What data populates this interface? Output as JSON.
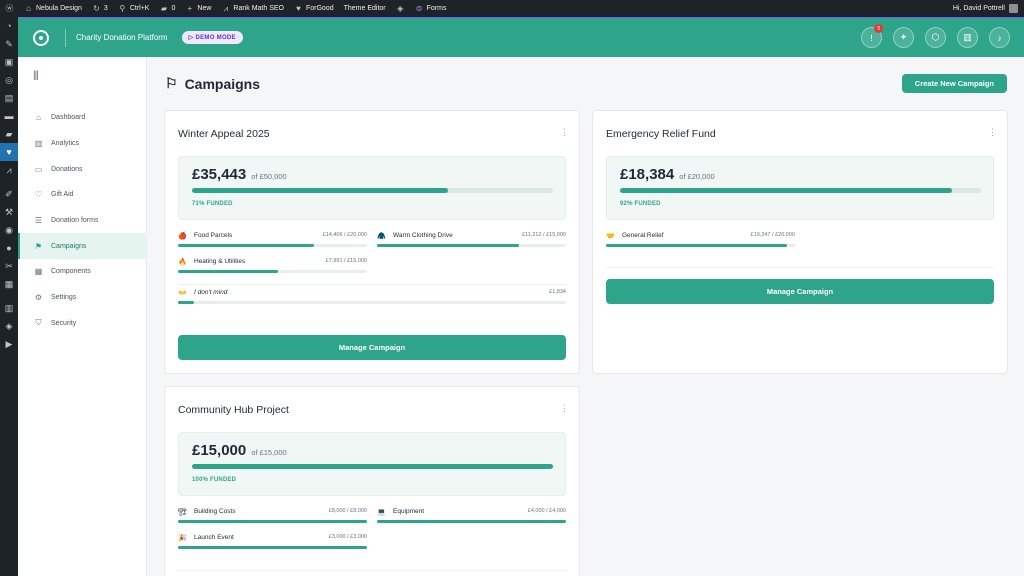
{
  "adminbar": {
    "site_name": "Nebula Design",
    "updates_count": "3",
    "shortcut": "Ctrl+K",
    "comments_count": "0",
    "new_label": "New",
    "rank_math": "Rank Math SEO",
    "forgood": "ForGood",
    "theme_editor": "Theme Editor",
    "forms": "Forms",
    "greeting": "Hi, David Pottrell"
  },
  "header": {
    "title": "Charity Donation Platform",
    "badge": "▷ DEMO MODE",
    "notification_count": "3"
  },
  "sidebar": {
    "items": [
      {
        "label": "Dashboard",
        "icon": "⌂"
      },
      {
        "label": "Analytics",
        "icon": "▥"
      },
      {
        "label": "Donations",
        "icon": "▭"
      },
      {
        "label": "Gift Aid",
        "icon": "♡"
      },
      {
        "label": "Donation forms",
        "icon": "☰"
      },
      {
        "label": "Campaigns",
        "icon": "⚑"
      },
      {
        "label": "Components",
        "icon": "▦"
      },
      {
        "label": "Settings",
        "icon": "⚙"
      },
      {
        "label": "Security",
        "icon": "⛉"
      }
    ]
  },
  "page": {
    "title": "Campaigns",
    "create_button": "Create New Campaign"
  },
  "campaigns": [
    {
      "title": "Winter Appeal 2025",
      "raised": "£35,443",
      "goal": "of £50,000",
      "progress": 71,
      "funded": "71% FUNDED",
      "manage": "Manage Campaign",
      "subs": [
        {
          "icon": "🍎",
          "name": "Food Parcels",
          "value": "£14,406 / £20,000",
          "progress": 72
        },
        {
          "icon": "🧥",
          "name": "Warm Clothing Drive",
          "value": "£11,212 / £15,000",
          "progress": 75
        },
        {
          "icon": "🔥",
          "name": "Heating & Utilities",
          "value": "£7,991 / £15,000",
          "progress": 53
        },
        {
          "icon": "👐",
          "name": "I don't mind",
          "value": "£1,834",
          "progress": 4
        }
      ]
    },
    {
      "title": "Emergency Relief Fund",
      "raised": "£18,384",
      "goal": "of £20,000",
      "progress": 92,
      "funded": "92% FUNDED",
      "manage": "Manage Campaign",
      "subs": [
        {
          "icon": "🤝",
          "name": "General Relief",
          "value": "£19,247 / £20,000",
          "progress": 96
        }
      ]
    },
    {
      "title": "Community Hub Project",
      "raised": "£15,000",
      "goal": "of £15,000",
      "progress": 100,
      "funded": "100% FUNDED",
      "subs": [
        {
          "icon": "🏗",
          "name": "Building Costs",
          "value": "£8,000 / £8,000",
          "progress": 100
        },
        {
          "icon": "💻",
          "name": "Equipment",
          "value": "£4,000 / £4,000",
          "progress": 100
        },
        {
          "icon": "🎉",
          "name": "Launch Event",
          "value": "£3,000 / £3,000",
          "progress": 100
        }
      ]
    }
  ],
  "colors": {
    "accent": "#2ea58a",
    "admin_bar": "#1d2327"
  }
}
